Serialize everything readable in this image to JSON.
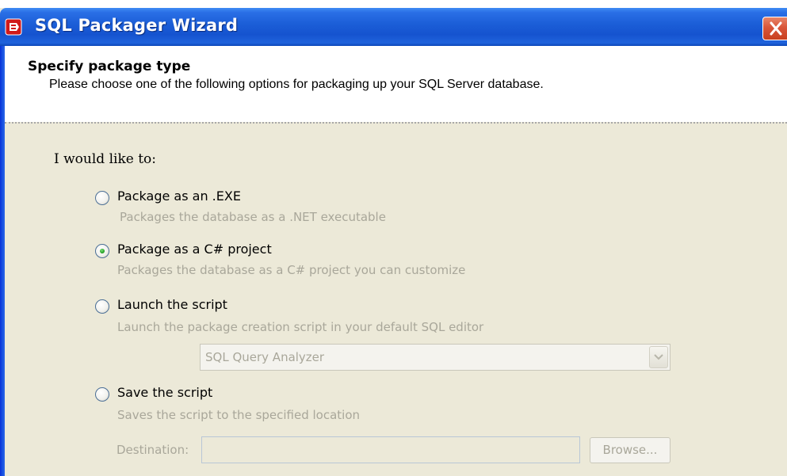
{
  "window": {
    "title": "SQL Packager Wizard"
  },
  "header": {
    "title": "Specify package type",
    "description": "Please choose one of the following options for packaging up your SQL Server database."
  },
  "body": {
    "intro": "I would like to:",
    "options": [
      {
        "label": "Package as an .EXE",
        "description": "Packages the database as a .NET executable",
        "selected": false
      },
      {
        "label": "Package as a C# project",
        "description": "Packages the database as a C# project you can customize",
        "selected": true
      },
      {
        "label": "Launch the script",
        "description": "Launch the package creation script in your default SQL editor",
        "selected": false
      },
      {
        "label": "Save the script",
        "description": "Saves the script to the specified location",
        "selected": false
      }
    ],
    "editor_select": {
      "value": "SQL Query Analyzer",
      "enabled": false
    },
    "destination": {
      "label": "Destination:",
      "value": "",
      "enabled": false
    },
    "browse_label": "Browse..."
  },
  "colors": {
    "titlebar": "#1553cf",
    "dialog_bg": "#ece9d8",
    "disabled_text": "#a9a79a",
    "close_button": "#d9563a"
  }
}
